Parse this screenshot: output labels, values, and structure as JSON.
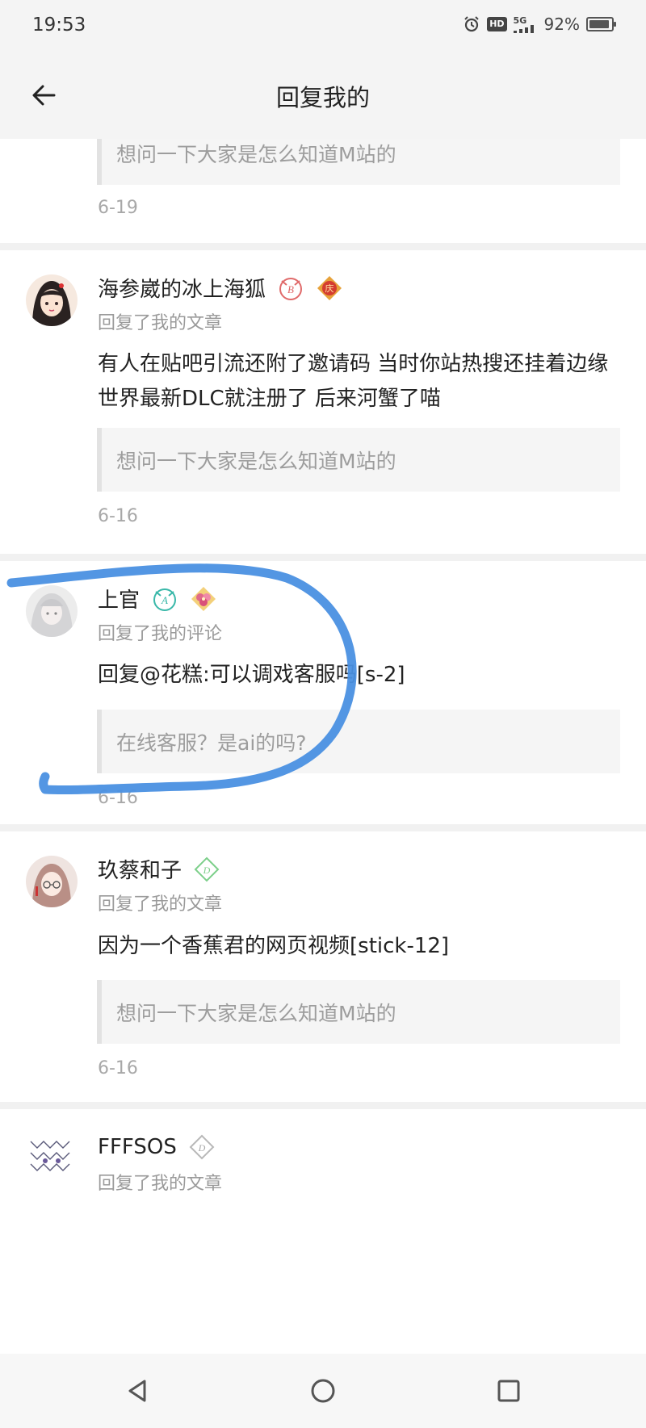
{
  "status_bar": {
    "time": "19:53",
    "icons": [
      "alarm-icon",
      "hd-icon",
      "5g-signal-icon",
      "battery-icon"
    ],
    "hd_label": "HD",
    "network_label": "5G",
    "battery_text": "92%",
    "battery_level": 0.92
  },
  "header": {
    "back_icon": "arrow-left-icon",
    "title": "回复我的"
  },
  "feed": [
    {
      "user": null,
      "action": null,
      "reply": null,
      "quote": "想问一下大家是怎么知道M站的",
      "date": "6-19"
    },
    {
      "user": "海参崴的冰上海狐",
      "badges": [
        "level-badge-icon",
        "fortune-badge-icon"
      ],
      "action": "回复了我的文章",
      "reply": "有人在贴吧引流还附了邀请码 当时你站热搜还挂着边缘世界最新DLC就注册了 后来河蟹了喵",
      "quote": "想问一下大家是怎么知道M站的",
      "date": "6-16"
    },
    {
      "user": "上官",
      "badges": [
        "level-badge-icon",
        "flower-badge-icon"
      ],
      "action": "回复了我的评论",
      "reply": "回复@花糕:可以调戏客服吗[s-2]",
      "quote": "在线客服？是ai的吗?",
      "date": "6-16"
    },
    {
      "user": "玖蔡和子",
      "badges": [
        "level-badge-icon"
      ],
      "action": "回复了我的文章",
      "reply": "因为一个香蕉君的网页视频[stick-12]",
      "quote": "想问一下大家是怎么知道M站的",
      "date": "6-16"
    },
    {
      "user": "FFFSOS",
      "badges": [
        "level-badge-icon"
      ],
      "action": "回复了我的文章",
      "reply": null,
      "quote": null,
      "date": null
    }
  ],
  "nav_bar": {
    "icons": [
      "back-triangle-icon",
      "home-circle-icon",
      "recents-square-icon"
    ]
  },
  "colors": {
    "bar_bg": "#f4f4f4",
    "secondary_text": "#9a9a9a",
    "quote_bg": "#f5f5f5",
    "scribble": "#4a90e2"
  }
}
